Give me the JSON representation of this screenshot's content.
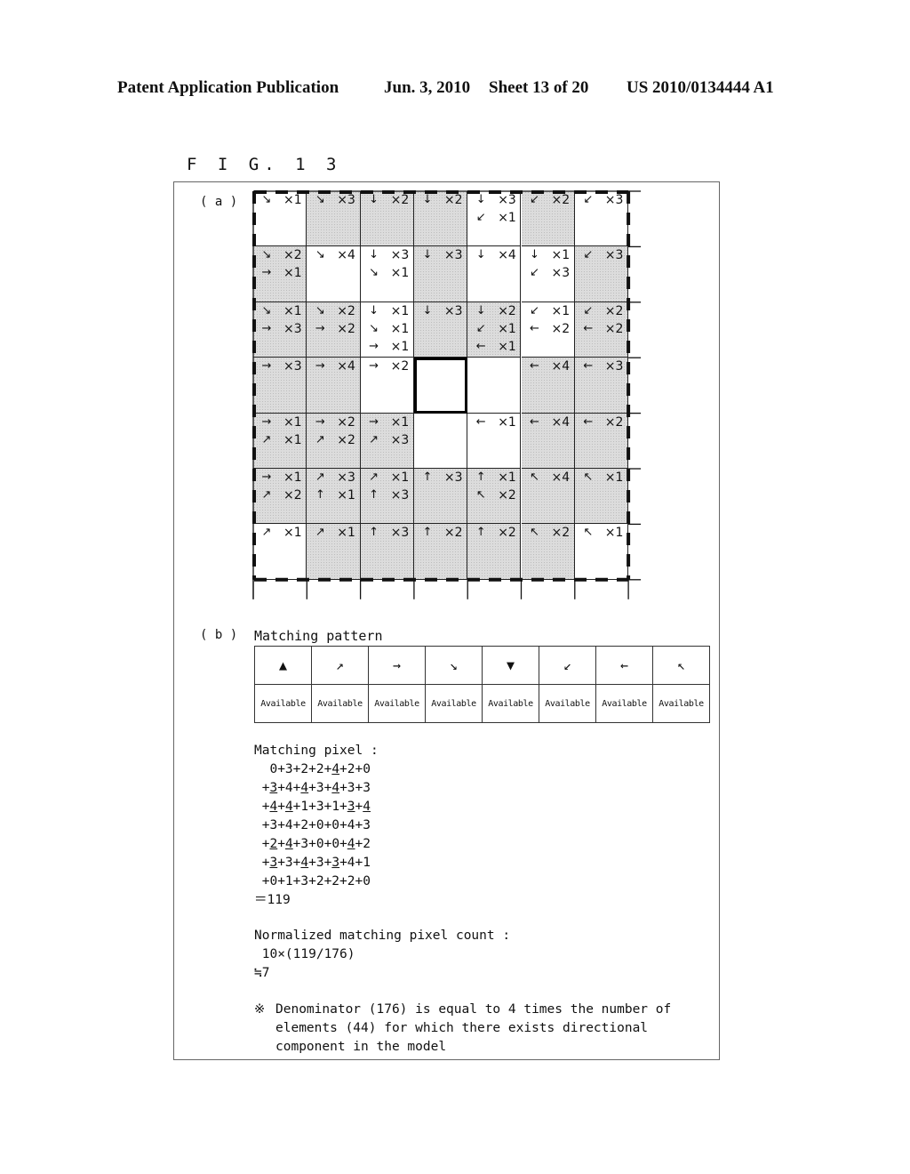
{
  "header": {
    "left": "Patent Application Publication",
    "date": "Jun. 3, 2010",
    "sheet": "Sheet 13 of 20",
    "number": "US 2010/0134444 A1"
  },
  "figure_title": "F I G. 1 3",
  "part_a_label": "( a )",
  "part_b_label": "( b )",
  "grid": {
    "rows": [
      [
        {
          "shade": false,
          "items": [
            [
              "↘",
              "×1"
            ]
          ]
        },
        {
          "shade": true,
          "items": [
            [
              "↘",
              "×3"
            ]
          ]
        },
        {
          "shade": true,
          "items": [
            [
              "↓",
              "×2"
            ]
          ]
        },
        {
          "shade": true,
          "items": [
            [
              "↓",
              "×2"
            ]
          ]
        },
        {
          "shade": false,
          "items": [
            [
              "↓",
              "×3"
            ],
            [
              "↙",
              "×1"
            ]
          ]
        },
        {
          "shade": true,
          "items": [
            [
              "↙",
              "×2"
            ]
          ]
        },
        {
          "shade": false,
          "items": [
            [
              "↙",
              "×3"
            ]
          ]
        }
      ],
      [
        {
          "shade": true,
          "items": [
            [
              "↘",
              "×2"
            ],
            [
              "→",
              "×1"
            ]
          ]
        },
        {
          "shade": false,
          "items": [
            [
              "↘",
              "×4"
            ]
          ]
        },
        {
          "shade": false,
          "items": [
            [
              "↓",
              "×3"
            ],
            [
              "↘",
              "×1"
            ]
          ]
        },
        {
          "shade": true,
          "items": [
            [
              "↓",
              "×3"
            ]
          ]
        },
        {
          "shade": false,
          "items": [
            [
              "↓",
              "×4"
            ]
          ]
        },
        {
          "shade": false,
          "items": [
            [
              "↓",
              "×1"
            ],
            [
              "↙",
              "×3"
            ]
          ]
        },
        {
          "shade": true,
          "items": [
            [
              "↙",
              "×3"
            ]
          ]
        }
      ],
      [
        {
          "shade": true,
          "items": [
            [
              "↘",
              "×1"
            ],
            [
              "→",
              "×3"
            ]
          ]
        },
        {
          "shade": true,
          "items": [
            [
              "↘",
              "×2"
            ],
            [
              "→",
              "×2"
            ]
          ]
        },
        {
          "shade": false,
          "items": [
            [
              "↓",
              "×1"
            ],
            [
              "↘",
              "×1"
            ],
            [
              "→",
              "×1"
            ]
          ]
        },
        {
          "shade": true,
          "items": [
            [
              "↓",
              "×3"
            ]
          ]
        },
        {
          "shade": true,
          "items": [
            [
              "↓",
              "×2"
            ],
            [
              "↙",
              "×1"
            ],
            [
              "←",
              "×1"
            ]
          ]
        },
        {
          "shade": false,
          "items": [
            [
              "↙",
              "×1"
            ],
            [
              "←",
              "×2"
            ]
          ]
        },
        {
          "shade": true,
          "items": [
            [
              "↙",
              "×2"
            ],
            [
              "←",
              "×2"
            ]
          ]
        }
      ],
      [
        {
          "shade": true,
          "items": [
            [
              "→",
              "×3"
            ]
          ]
        },
        {
          "shade": true,
          "items": [
            [
              "→",
              "×4"
            ]
          ]
        },
        {
          "shade": false,
          "items": [
            [
              "→",
              "×2"
            ]
          ]
        },
        {
          "shade": false,
          "center": true,
          "items": []
        },
        {
          "shade": false,
          "items": []
        },
        {
          "shade": true,
          "items": [
            [
              "←",
              "×4"
            ]
          ]
        },
        {
          "shade": true,
          "items": [
            [
              "←",
              "×3"
            ]
          ]
        }
      ],
      [
        {
          "shade": true,
          "items": [
            [
              "→",
              "×1"
            ],
            [
              "↗",
              "×1"
            ]
          ]
        },
        {
          "shade": true,
          "items": [
            [
              "→",
              "×2"
            ],
            [
              "↗",
              "×2"
            ]
          ]
        },
        {
          "shade": true,
          "items": [
            [
              "→",
              "×1"
            ],
            [
              "↗",
              "×3"
            ]
          ]
        },
        {
          "shade": false,
          "items": []
        },
        {
          "shade": false,
          "items": [
            [
              "←",
              "×1"
            ]
          ]
        },
        {
          "shade": true,
          "items": [
            [
              "←",
              "×4"
            ]
          ]
        },
        {
          "shade": true,
          "items": [
            [
              "←",
              "×2"
            ]
          ]
        }
      ],
      [
        {
          "shade": true,
          "items": [
            [
              "→",
              "×1"
            ],
            [
              "↗",
              "×2"
            ]
          ]
        },
        {
          "shade": true,
          "items": [
            [
              "↗",
              "×3"
            ],
            [
              "↑",
              "×1"
            ]
          ]
        },
        {
          "shade": true,
          "items": [
            [
              "↗",
              "×1"
            ],
            [
              "↑",
              "×3"
            ]
          ]
        },
        {
          "shade": true,
          "items": [
            [
              "↑",
              "×3"
            ]
          ]
        },
        {
          "shade": true,
          "items": [
            [
              "↑",
              "×1"
            ],
            [
              "↖",
              "×2"
            ]
          ]
        },
        {
          "shade": true,
          "items": [
            [
              "↖",
              "×4"
            ]
          ]
        },
        {
          "shade": true,
          "items": [
            [
              "↖",
              "×1"
            ]
          ]
        }
      ],
      [
        {
          "shade": false,
          "items": [
            [
              "↗",
              "×1"
            ]
          ]
        },
        {
          "shade": true,
          "items": [
            [
              "↗",
              "×1"
            ]
          ]
        },
        {
          "shade": true,
          "items": [
            [
              "↑",
              "×3"
            ]
          ]
        },
        {
          "shade": true,
          "items": [
            [
              "↑",
              "×2"
            ]
          ]
        },
        {
          "shade": true,
          "items": [
            [
              "↑",
              "×2"
            ]
          ]
        },
        {
          "shade": true,
          "items": [
            [
              "↖",
              "×2"
            ]
          ]
        },
        {
          "shade": false,
          "items": [
            [
              "↖",
              "×1"
            ]
          ]
        }
      ]
    ]
  },
  "matching_pattern": {
    "title": "Matching pattern",
    "arrows": [
      "▲",
      "↗",
      "→",
      "↘",
      "▼",
      "↙",
      "←",
      "↖"
    ],
    "status": [
      "Available",
      "Available",
      "Available",
      "Available",
      "Available",
      "Available",
      "Available",
      "Available"
    ]
  },
  "matching_pixel": {
    "title": "Matching pixel :",
    "lines": [
      "  0+3+2+2+<u>4</u>+2+0",
      " +<u>3</u>+4+<u>4</u>+3+<u>4</u>+3+3",
      " +<u>4</u>+<u>4</u>+1+3+1+<u>3</u>+<u>4</u>",
      " +3+4+2+0+0+4+3",
      " +<u>2</u>+<u>4</u>+3+0+0+<u>4</u>+2",
      " +<u>3</u>+3+<u>4</u>+3+<u>3</u>+4+1",
      " +0+1+3+2+2+2+0"
    ],
    "result": "＝119"
  },
  "normalized": {
    "title": "Normalized matching pixel count :",
    "formula": " 10×(119/176)",
    "result": "≒7"
  },
  "note": {
    "mark": "※",
    "lines": [
      "Denominator (176) is equal to 4 times the number of",
      "elements (44) for which there exists directional",
      "component in the model"
    ]
  }
}
